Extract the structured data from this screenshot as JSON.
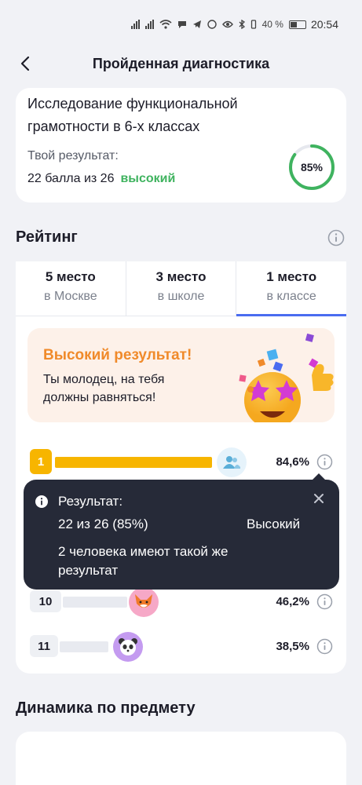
{
  "status_bar": {
    "battery": "40 %",
    "time": "20:54"
  },
  "header": {
    "title": "Пройденная диагностика"
  },
  "result": {
    "title": "Исследование функциональной грамотности в 6-х классах",
    "label": "Твой результат:",
    "score": "22 балла из 26",
    "level": "высокий",
    "percent_text": "85%",
    "percent_value": 85,
    "ring_color": "#3fb35f"
  },
  "rating": {
    "title": "Рейтинг",
    "tabs": [
      {
        "place": "5 место",
        "where": "в Москве",
        "active": false
      },
      {
        "place": "3 место",
        "where": "в школе",
        "active": false
      },
      {
        "place": "1 место",
        "where": "в классе",
        "active": true
      }
    ],
    "banner": {
      "title": "Высокий результат!",
      "text": "Ты молодец, на тебя должны равняться!"
    },
    "rows": [
      {
        "rank": "1",
        "percent": "84,6%",
        "value": 84.6,
        "avatar": "users-icon"
      },
      {
        "rank": "10",
        "percent": "46,2%",
        "value": 46.2,
        "avatar": "fox-avatar"
      },
      {
        "rank": "11",
        "percent": "38,5%",
        "value": 38.5,
        "avatar": "panda-avatar"
      }
    ]
  },
  "tooltip": {
    "title": "Результат:",
    "score": "22 из 26 (85%)",
    "level": "Высокий",
    "note": "2 человека имеют такой же результат"
  },
  "dynamics": {
    "title": "Динамика по предмету"
  },
  "colors": {
    "accent": "#4a6cf0",
    "gold": "#f7b500",
    "success": "#3fb35f",
    "orange": "#f08a2a"
  }
}
